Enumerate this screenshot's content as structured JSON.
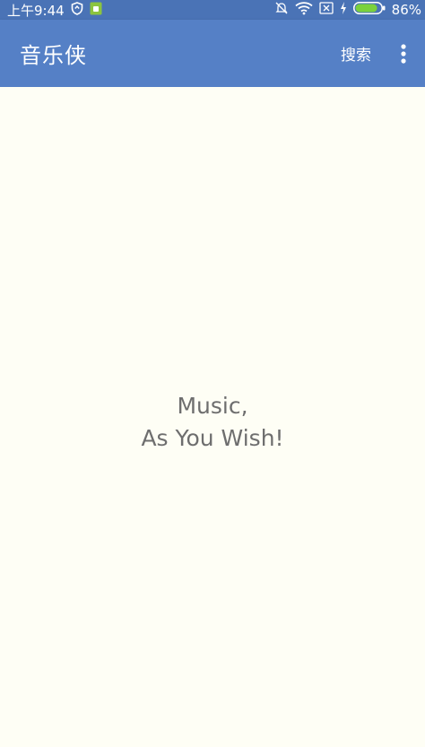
{
  "status_bar": {
    "time": "上午9:44",
    "battery_percent": "86%",
    "battery_level": 0.86,
    "icons": [
      "shield-icon",
      "sim-icon",
      "bell-off-icon",
      "wifi-icon",
      "no-sim-icon",
      "charging-icon",
      "battery-icon"
    ]
  },
  "app_bar": {
    "title": "音乐侠",
    "search_label": "搜索",
    "overflow_icon": "more-vert-icon",
    "color": "#5580c6"
  },
  "main": {
    "slogan_line1": "Music,",
    "slogan_line2": "As You Wish!"
  }
}
